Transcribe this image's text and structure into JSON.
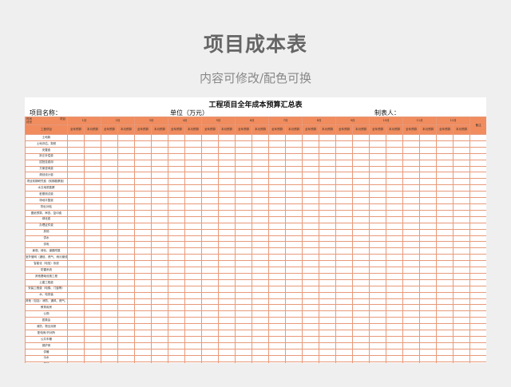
{
  "page": {
    "title": "项目成本表",
    "subtitle": "内容可修改/配色可换"
  },
  "sheet": {
    "title": "工程项目全年成本预算汇总表",
    "project_label": "项目名称：",
    "unit_label": "单位（万元）",
    "maker_label": "制表人：",
    "corner": {
      "top": "项目",
      "middle": "时间",
      "bottom": "月份"
    },
    "item_header": "工程项目",
    "months": [
      "1月",
      "2月",
      "3月",
      "4月",
      "5月",
      "6月",
      "7月",
      "8月",
      "9月",
      "10月",
      "11月",
      "12月"
    ],
    "sub_cols": [
      "全年预算",
      "本月预算"
    ],
    "remark": "备注",
    "rows": [
      "土地款",
      "土地评估、契税",
      "安置费",
      "拆迁补偿费",
      "招拍挂费用",
      "方案咨询费",
      "规划设计费",
      "项目前期研究费（前期勘察费）",
      "水文地质勘察",
      "桩基测试费",
      "场地平整费",
      "物业补贴",
      "图纸预算、审查、复印费",
      "绿化费",
      "办理证件费",
      "其他",
      "供水",
      "供电",
      "景观、绿化、道路附属",
      "室外管网（通信、燃气、雨污管线等）",
      "智能化（电信）系统",
      "防雷系统",
      "其他基础设施工程",
      "土建工程费",
      "安装工程费（电梯、门窗等）",
      "水、电安装",
      "其他（包括：消防、通风、燃气、弱电系统、电子等）",
      "教育用房",
      "公厕",
      "居委会",
      "消防、物业用房",
      "配电房/开闭所",
      "公共车棚",
      "锅炉房",
      "供暖",
      "污水",
      "其他",
      "建筑面积测绘费",
      "监理费",
      "桩基测试",
      "基础检测费"
    ]
  }
}
